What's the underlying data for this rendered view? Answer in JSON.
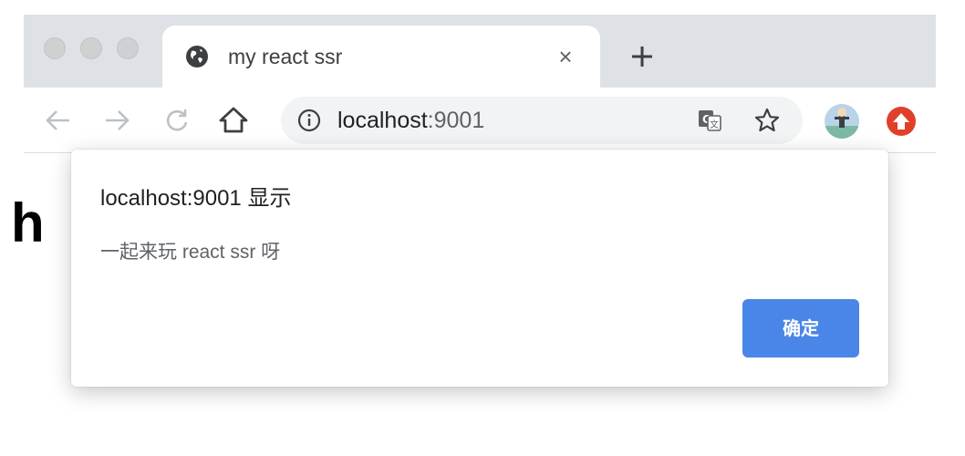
{
  "browser": {
    "tab": {
      "title": "my react ssr",
      "close_glyph": "×",
      "favicon": "globe-icon"
    },
    "new_tab_icon": "plus-icon",
    "toolbar": {
      "back_icon": "arrow-left-icon",
      "forward_icon": "arrow-right-icon",
      "reload_icon": "reload-icon",
      "home_icon": "home-icon",
      "url_host": "localhost",
      "url_port": ":9001",
      "site_info_icon": "info-icon",
      "translate_icon": "translate-icon",
      "bookmark_icon": "star-icon",
      "profile_icon": "avatar",
      "extension_icon": "extension-icon"
    }
  },
  "page": {
    "heading_fragment": "h"
  },
  "dialog": {
    "title": "localhost:9001 显示",
    "message": "一起来玩 react ssr 呀",
    "ok_label": "确定"
  },
  "colors": {
    "accent": "#4a86e8",
    "tabstrip": "#dee1e6",
    "omnibox": "#f1f3f4",
    "extension": "#e0402a"
  }
}
